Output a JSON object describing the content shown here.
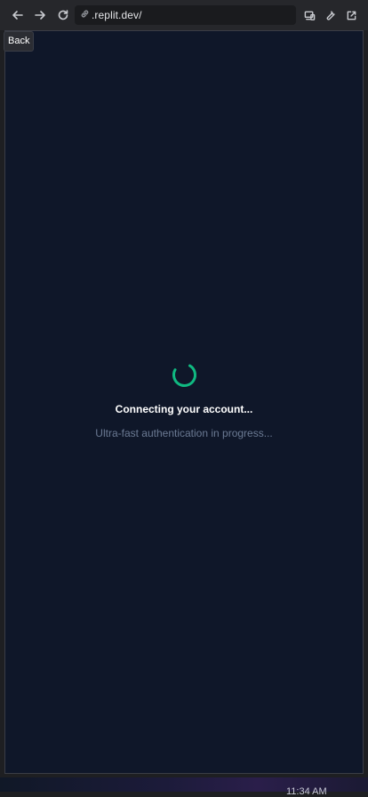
{
  "browser": {
    "url": ".replit.dev/",
    "back_label": "Back"
  },
  "page": {
    "title": "Connecting your account...",
    "subtitle": "Ultra-fast authentication in progress...",
    "spinner_color": "#10b981",
    "background": "#0f1729"
  },
  "taskbar": {
    "clock": "11:34 AM"
  },
  "icons": [
    "arrow-left-icon",
    "arrow-right-icon",
    "reload-icon",
    "link-icon",
    "devices-icon",
    "wrench-icon",
    "external-link-icon",
    "spinner-icon"
  ]
}
